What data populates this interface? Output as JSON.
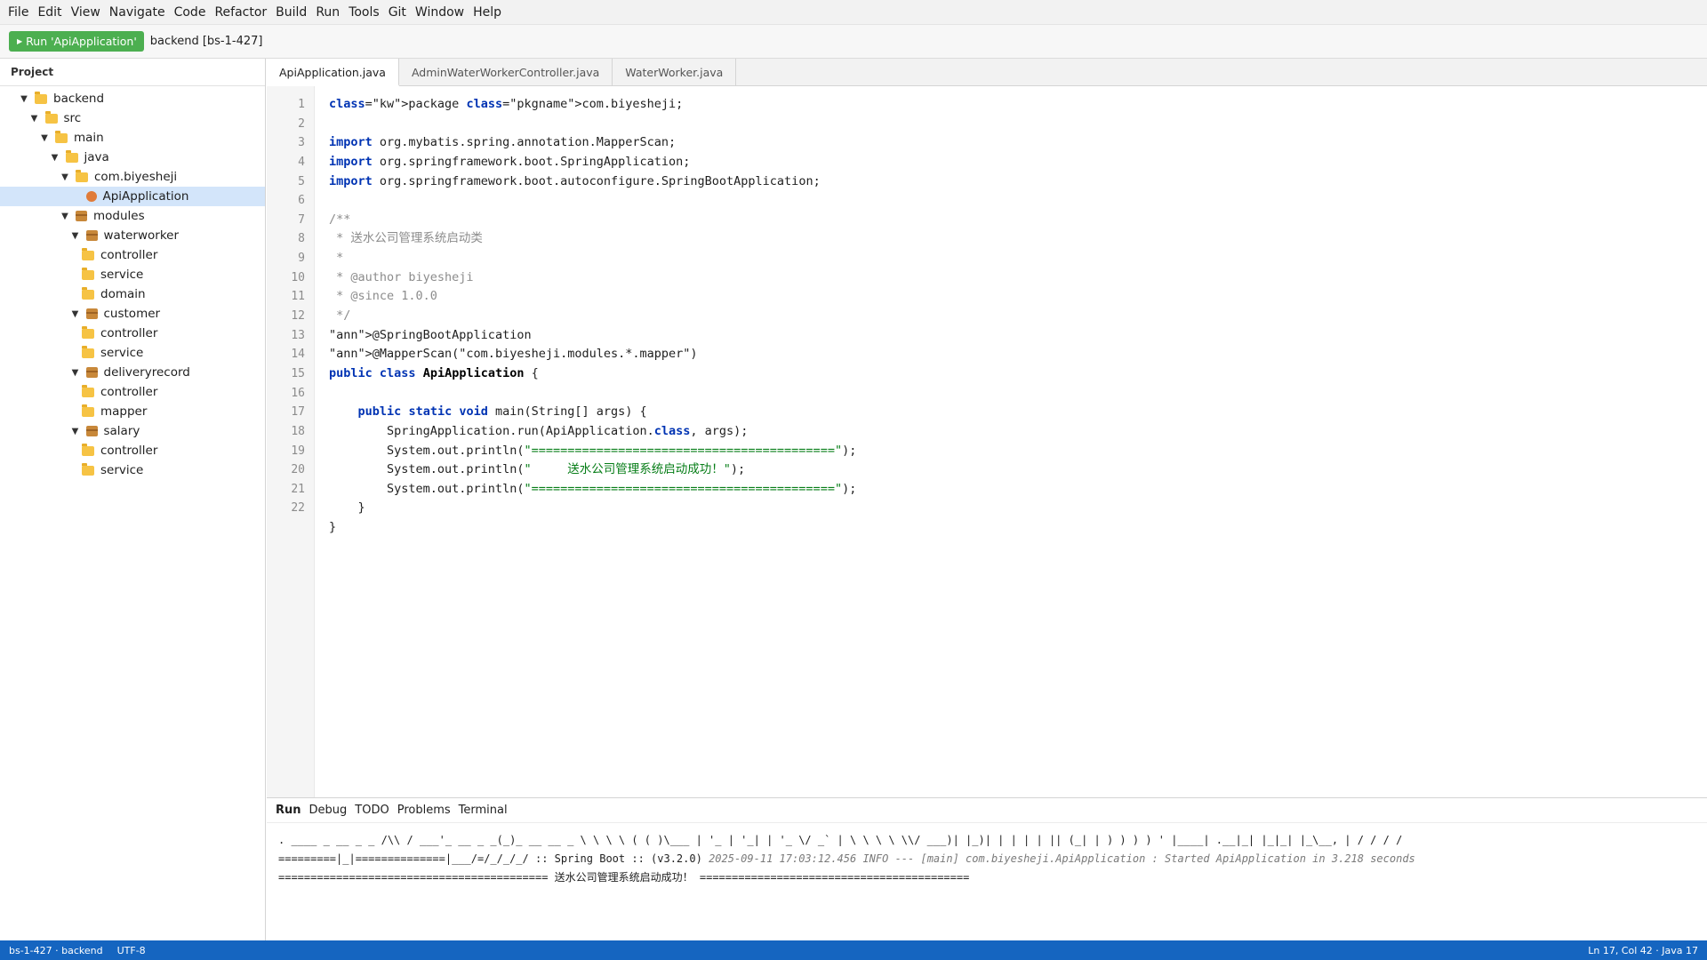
{
  "menu": [
    "File",
    "Edit",
    "View",
    "Navigate",
    "Code",
    "Refactor",
    "Build",
    "Run",
    "Tools",
    "Git",
    "Window",
    "Help"
  ],
  "toolbar": {
    "run_label": "Run 'ApiApplication'",
    "config_label": "backend [bs-1-427]"
  },
  "project": {
    "header": "Project",
    "tree": [
      {
        "label": "backend",
        "icon": "folder-icon",
        "arrow": "expanded"
      },
      {
        "label": "src",
        "icon": "folder-icon",
        "arrow": "expanded"
      },
      {
        "label": "main",
        "icon": "folder-icon",
        "arrow": "expanded"
      },
      {
        "label": "java",
        "icon": "folder-icon",
        "arrow": "expanded"
      },
      {
        "label": "com.biyesheji",
        "icon": "folder-icon",
        "arrow": "expanded"
      },
      {
        "label": "ApiApplication",
        "icon": "java-file-icon",
        "arrow": "none",
        "selected": true
      },
      {
        "label": "modules",
        "icon": "package-icon",
        "arrow": "expanded"
      },
      {
        "label": "waterworker",
        "icon": "package-icon",
        "arrow": "expanded"
      },
      {
        "label": "controller",
        "icon": "folder-icon",
        "arrow": "none"
      },
      {
        "label": "service",
        "icon": "folder-icon",
        "arrow": "none"
      },
      {
        "label": "domain",
        "icon": "folder-icon",
        "arrow": "none"
      },
      {
        "label": "customer",
        "icon": "package-icon",
        "arrow": "expanded"
      },
      {
        "label": "controller",
        "icon": "folder-icon",
        "arrow": "none"
      },
      {
        "label": "service",
        "icon": "folder-icon",
        "arrow": "none"
      },
      {
        "label": "deliveryrecord",
        "icon": "package-icon",
        "arrow": "expanded"
      },
      {
        "label": "controller",
        "icon": "folder-icon",
        "arrow": "none"
      },
      {
        "label": "mapper",
        "icon": "folder-icon",
        "arrow": "none"
      },
      {
        "label": "salary",
        "icon": "package-icon",
        "arrow": "expanded"
      },
      {
        "label": "controller",
        "icon": "folder-icon",
        "arrow": "none"
      },
      {
        "label": "service",
        "icon": "folder-icon",
        "arrow": "none"
      }
    ]
  },
  "tabs": [
    {
      "label": "ApiApplication.java",
      "active": true
    },
    {
      "label": "AdminWaterWorkerController.java",
      "active": false
    },
    {
      "label": "WaterWorker.java",
      "active": false
    }
  ],
  "editor": {
    "line_numbers": [
      "1",
      "2",
      "3",
      "4",
      "5",
      "6",
      "7",
      "8",
      "9",
      "10",
      "11",
      "12",
      "13",
      "14",
      "15",
      "16",
      "17",
      "18",
      "19",
      "20",
      "21",
      "22"
    ],
    "code": [
      "package com.biyesheji;",
      "",
      "import org.mybatis.spring.annotation.MapperScan;",
      "import org.springframework.boot.SpringApplication;",
      "import org.springframework.boot.autoconfigure.SpringBootApplication;",
      "",
      "/**",
      " * 送水公司管理系统启动类",
      " *",
      " * @author biyesheji",
      " * @since 1.0.0",
      " */",
      "@SpringBootApplication",
      "@MapperScan(\"com.biyesheji.modules.*.mapper\")",
      "public class ApiApplication {",
      "",
      "    public static void main(String[] args) {",
      "        SpringApplication.run(ApiApplication.class, args);",
      "        System.out.println(\"==========================================\");",
      "        System.out.println(\"     送水公司管理系统启动成功！\");",
      "        System.out.println(\"==========================================\");",
      "    }",
      "}"
    ]
  },
  "bottom": {
    "tabs": [
      "Run",
      "Debug",
      "TODO",
      "Problems",
      "Terminal"
    ],
    "active_tab": "Run",
    "console": [
      ". ____ _ __ _ _ /\\\\ / ___'_ __ _ _(_)_ __ __ _ \\ \\ \\ \\ ( ( )\\___ | '_ | '_| | '_ \\/ _` | \\ \\ \\ \\ \\\\/ ___)| |_)| | | | | || (_| | ) ) ) ) ' |____| .__|_| |_|_| |_\\__, | / / / /",
      "=========|_|==============|___/=/_/_/_/ :: Spring Boot :: (v3.2.0)",
      "2025-09-11 17:03:12.456 INFO --- [main] com.biyesheji.ApiApplication : Started ApiApplication in 3.218 seconds",
      "========================================== 送水公司管理系统启动成功！ =========================================="
    ]
  },
  "status": {
    "project": "bs-1-427 · backend",
    "encoding": "UTF-8",
    "position": "Ln 17, Col 42 · Java 17"
  },
  "colors": {
    "run_button": "#4caf50",
    "statusbar": "#1565c0",
    "selection": "#d3e5fa",
    "keyword": "#0033b3",
    "string": "#067d17"
  }
}
